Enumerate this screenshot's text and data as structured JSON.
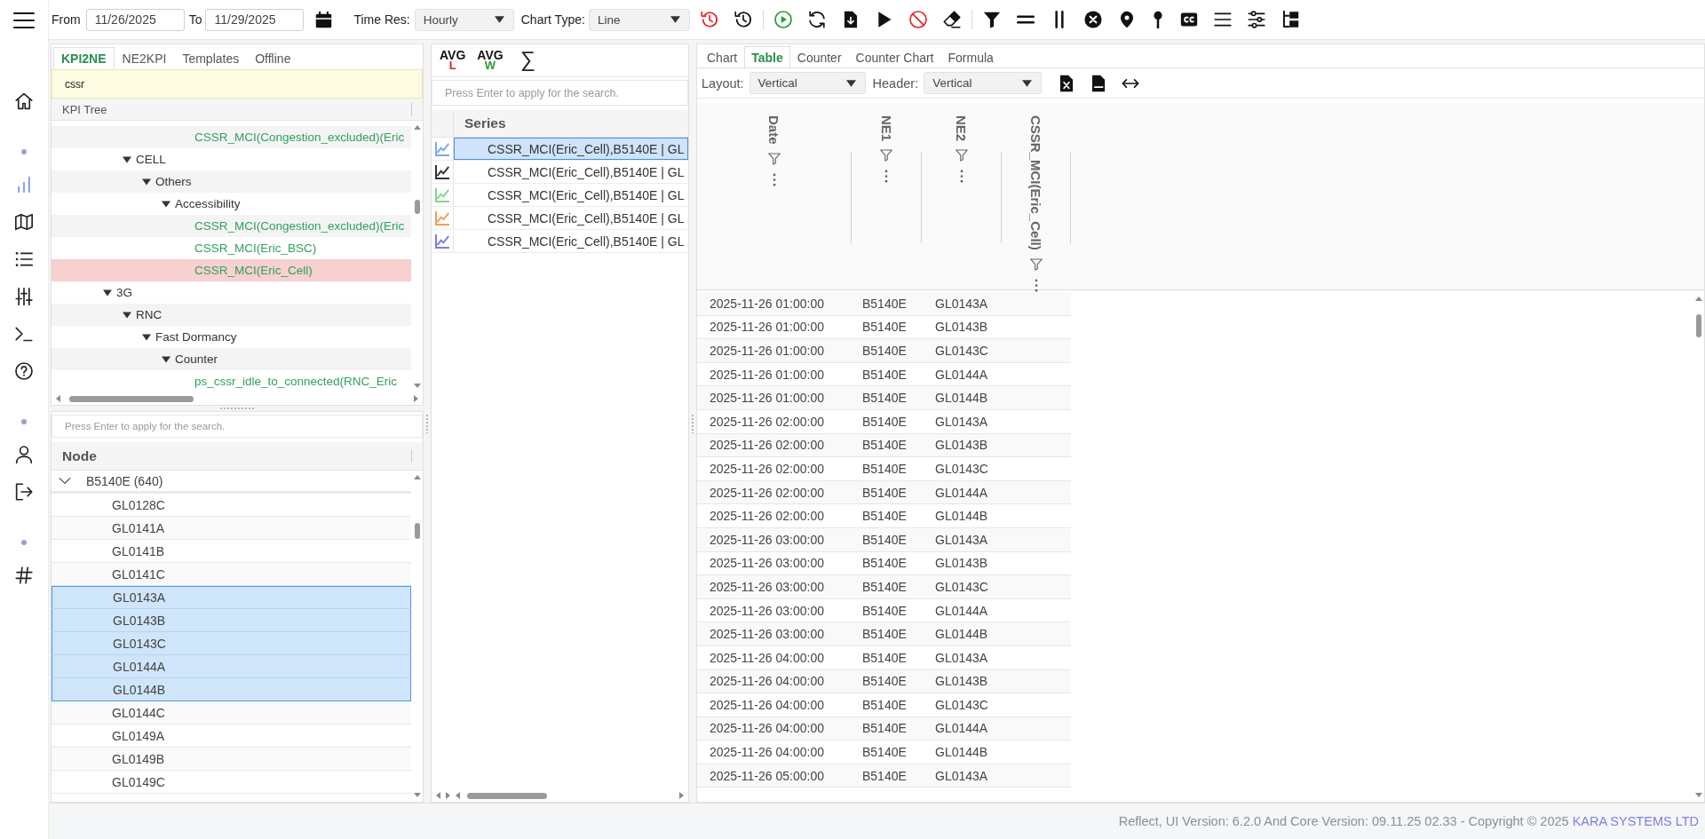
{
  "toolbar": {
    "from": {
      "label": "From",
      "value": "11/26/2025"
    },
    "to": {
      "label": "To",
      "value": "11/29/2025"
    },
    "time_res": {
      "label": "Time Res:",
      "value": "Hourly"
    },
    "chart_type": {
      "label": "Chart Type:",
      "value": "Line"
    }
  },
  "sidebar": {
    "groups": [
      {
        "items": [
          {
            "selected": false
          }
        ]
      },
      {
        "items": [
          {
            "selected": true
          },
          {
            "selected": false
          },
          {
            "selected": false
          },
          {
            "selected": false
          },
          {
            "selected": false
          },
          {
            "selected": false
          }
        ]
      },
      {
        "items": [
          {
            "selected": false
          },
          {
            "selected": false
          }
        ]
      },
      {
        "items": [
          {
            "selected": false
          }
        ]
      }
    ]
  },
  "kpi_panel": {
    "tabs": [
      {
        "label": "KPI2NE",
        "selected": true
      },
      {
        "label": "NE2KPI",
        "selected": false
      },
      {
        "label": "Templates",
        "selected": false
      },
      {
        "label": "Offline",
        "selected": false
      }
    ],
    "search": {
      "value": "cssr"
    },
    "tree_header": "KPI Tree",
    "tree": [
      {
        "children": [
          {
            "children": [
              {
                "children": [
                  {
                    "children": [
                      {
                        "label": "CSSR_MCI(Congestion_excluded)(Eric",
                        "kind": "kpi",
                        "selected": false
                      }
                    ]
                  }
                ]
              }
            ]
          },
          {
            "label": "CELL",
            "kind": "folder",
            "expanded": true,
            "selected": false,
            "children": [
              {
                "label": "Others",
                "kind": "folder",
                "expanded": true,
                "selected": false,
                "children": [
                  {
                    "label": "Accessibility",
                    "kind": "folder",
                    "expanded": true,
                    "selected": false,
                    "children": [
                      {
                        "label": "CSSR_MCI(Congestion_excluded)(Eric",
                        "kind": "kpi",
                        "selected": false
                      },
                      {
                        "label": "CSSR_MCI(Eric_BSC)",
                        "kind": "kpi",
                        "selected": false
                      },
                      {
                        "label": "CSSR_MCI(Eric_Cell)",
                        "kind": "kpi",
                        "selected": true
                      }
                    ]
                  }
                ]
              }
            ]
          }
        ]
      },
      {
        "label": "3G",
        "kind": "folder",
        "expanded": true,
        "selected": false,
        "children": [
          {
            "label": "RNC",
            "kind": "folder",
            "expanded": true,
            "selected": false,
            "children": [
              {
                "label": "Fast Dormancy",
                "kind": "folder",
                "expanded": true,
                "selected": false,
                "children": [
                  {
                    "label": "Counter",
                    "kind": "folder",
                    "expanded": true,
                    "selected": false,
                    "children": [
                      {
                        "label": "ps_cssr_idle_to_connected(RNC_Eric",
                        "kind": "kpi",
                        "selected": false
                      }
                    ]
                  }
                ]
              }
            ]
          }
        ]
      }
    ]
  },
  "node_panel": {
    "search": {
      "placeholder": "Press Enter to apply for the search."
    },
    "header": "Node",
    "tree": [
      {
        "label": "B5140E (640)",
        "expanded": true,
        "selected": false,
        "children": [
          {
            "label": "GL0128C",
            "selected": false
          },
          {
            "label": "GL0141A",
            "selected": false
          },
          {
            "label": "GL0141B",
            "selected": false
          },
          {
            "label": "GL0141C",
            "selected": false
          },
          {
            "label": "GL0143A",
            "selected": true
          },
          {
            "label": "GL0143B",
            "selected": true
          },
          {
            "label": "GL0143C",
            "selected": true
          },
          {
            "label": "GL0144A",
            "selected": true
          },
          {
            "label": "GL0144B",
            "selected": true
          },
          {
            "label": "GL0144C",
            "selected": false
          },
          {
            "label": "GL0149A",
            "selected": false
          },
          {
            "label": "GL0149B",
            "selected": false
          },
          {
            "label": "GL0149C",
            "selected": false
          }
        ]
      }
    ]
  },
  "series_panel": {
    "averages": [
      {
        "label": "AVG",
        "sub": "L",
        "color": "#e02424"
      },
      {
        "label": "AVG",
        "sub": "W",
        "color": "#2e9a3e"
      }
    ],
    "sum": "∑",
    "search": {
      "placeholder": "Press Enter to apply for the search."
    },
    "header": "Series",
    "rows": [
      {
        "label": "CSSR_MCI(Eric_Cell),B5140E | GL",
        "color": "#7ea6e8",
        "selected": true
      },
      {
        "label": "CSSR_MCI(Eric_Cell),B5140E | GL",
        "color": "#333333",
        "selected": false
      },
      {
        "label": "CSSR_MCI(Eric_Cell),B5140E | GL",
        "color": "#7fd88a",
        "selected": false
      },
      {
        "label": "CSSR_MCI(Eric_Cell),B5140E | GL",
        "color": "#f0a05a",
        "selected": false
      },
      {
        "label": "CSSR_MCI(Eric_Cell),B5140E | GL",
        "color": "#7b80e0",
        "selected": false
      }
    ]
  },
  "result_panel": {
    "tabs": [
      {
        "label": "Chart",
        "selected": false
      },
      {
        "label": "Table",
        "selected": true
      },
      {
        "label": "Counter",
        "selected": false
      },
      {
        "label": "Counter Chart",
        "selected": false
      },
      {
        "label": "Formula",
        "selected": false
      }
    ],
    "layout": {
      "label": "Layout:",
      "value": "Vertical"
    },
    "header_mode": {
      "label": "Header:",
      "value": "Vertical"
    },
    "table": {
      "columns": [
        "Date",
        "NE1",
        "NE2",
        "CSSR_MCI(Eric_Cell)"
      ],
      "rows": [
        [
          "2025-11-26 01:00:00",
          "B5140E",
          "GL0143A"
        ],
        [
          "2025-11-26 01:00:00",
          "B5140E",
          "GL0143B"
        ],
        [
          "2025-11-26 01:00:00",
          "B5140E",
          "GL0143C"
        ],
        [
          "2025-11-26 01:00:00",
          "B5140E",
          "GL0144A"
        ],
        [
          "2025-11-26 01:00:00",
          "B5140E",
          "GL0144B"
        ],
        [
          "2025-11-26 02:00:00",
          "B5140E",
          "GL0143A"
        ],
        [
          "2025-11-26 02:00:00",
          "B5140E",
          "GL0143B"
        ],
        [
          "2025-11-26 02:00:00",
          "B5140E",
          "GL0143C"
        ],
        [
          "2025-11-26 02:00:00",
          "B5140E",
          "GL0144A"
        ],
        [
          "2025-11-26 02:00:00",
          "B5140E",
          "GL0144B"
        ],
        [
          "2025-11-26 03:00:00",
          "B5140E",
          "GL0143A"
        ],
        [
          "2025-11-26 03:00:00",
          "B5140E",
          "GL0143B"
        ],
        [
          "2025-11-26 03:00:00",
          "B5140E",
          "GL0143C"
        ],
        [
          "2025-11-26 03:00:00",
          "B5140E",
          "GL0144A"
        ],
        [
          "2025-11-26 03:00:00",
          "B5140E",
          "GL0144B"
        ],
        [
          "2025-11-26 04:00:00",
          "B5140E",
          "GL0143A"
        ],
        [
          "2025-11-26 04:00:00",
          "B5140E",
          "GL0143B"
        ],
        [
          "2025-11-26 04:00:00",
          "B5140E",
          "GL0143C"
        ],
        [
          "2025-11-26 04:00:00",
          "B5140E",
          "GL0144A"
        ],
        [
          "2025-11-26 04:00:00",
          "B5140E",
          "GL0144B"
        ],
        [
          "2025-11-26 05:00:00",
          "B5140E",
          "GL0143A"
        ]
      ]
    }
  },
  "status_bar": {
    "text": "Reflect, UI Version: 6.2.0 And Core Version: 09.11.25 02.33 - Copyright © 2025",
    "link": "KARA SYSTEMS LTD"
  }
}
